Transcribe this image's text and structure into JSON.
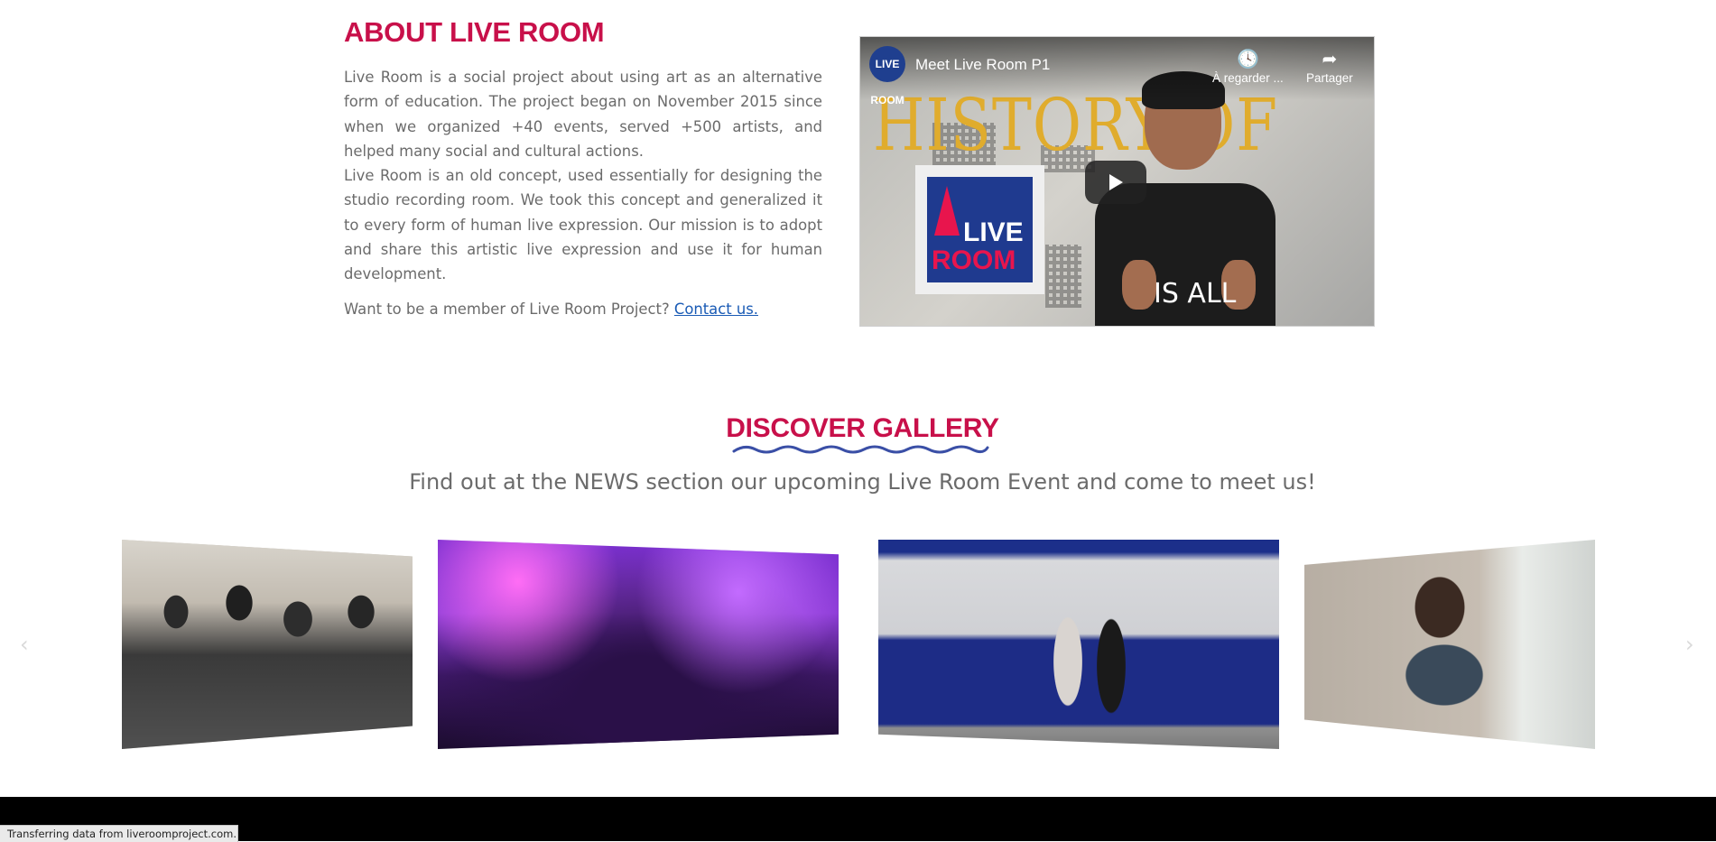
{
  "about": {
    "title": "ABOUT LIVE ROOM",
    "paragraph_1": "Live Room is a social project about using art as an alternative form of education. The project began on November 2015 since when we organized +40 events, served +500 artists, and helped many social and cultural actions.",
    "paragraph_2": "Live Room is an old concept, used essentially for designing the studio recording room. We took this concept and generalized it to every form of human live expression. Our mission is to adopt and share this artistic live expression and use it for human development.",
    "member_text": "Want to be a member of Live Room Project?",
    "contact_link": "Contact us."
  },
  "video": {
    "title": "Meet Live Room P1",
    "channel_logo": "LIVE ROOM",
    "watch_later": "À regarder ...",
    "share": "Partager",
    "overlay_text": "HISTORY OF",
    "poster_line_1": "LIVE",
    "poster_line_2": "ROOM",
    "shirt_text": "IS ALL"
  },
  "gallery": {
    "title": "DISCOVER GALLERY",
    "subtitle": "Find out at the NEWS section our upcoming Live Room Event and come to meet us!",
    "prev_icon": "‹",
    "next_icon": "›",
    "slides": [
      {
        "name": "exhibition-crowd"
      },
      {
        "name": "party-purple-lights"
      },
      {
        "name": "costumed-pair"
      },
      {
        "name": "artist-at-table"
      }
    ]
  },
  "status_bar": {
    "text": "Transferring data from liveroomproject.com..."
  },
  "colors": {
    "accent": "#c8104a",
    "link": "#1a5bb5",
    "wave": "#3a4fa6",
    "footer": "#000000"
  }
}
